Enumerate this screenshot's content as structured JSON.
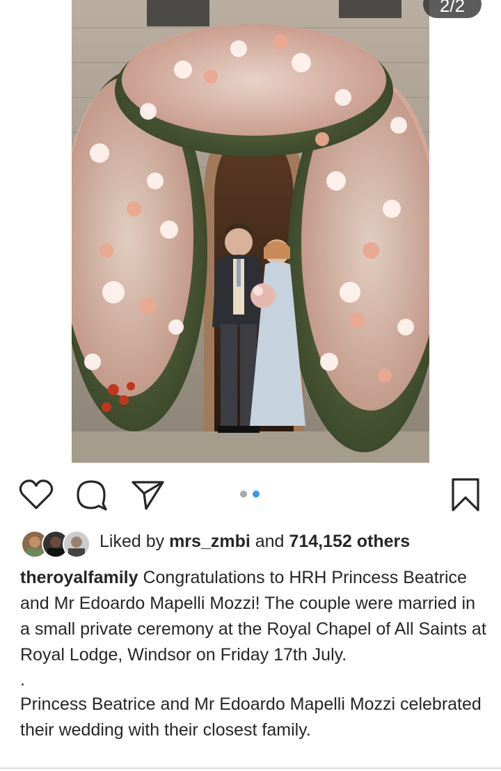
{
  "post": {
    "image_alt": "Wedding photo: couple in front of a floral arch at a chapel doorway",
    "carousel_counter": "2/2",
    "carousel": {
      "total": 2,
      "active_index": 1
    }
  },
  "actions": {
    "like_icon": "heart-icon",
    "comment_icon": "comment-icon",
    "share_icon": "share-icon",
    "save_icon": "bookmark-icon"
  },
  "likes": {
    "prefix": "Liked by",
    "user": "mrs_zmbi",
    "middle": "and",
    "count_text": "714,152 others"
  },
  "caption": {
    "username": "theroyalfamily",
    "text": " Congratulations to HRH Princess Beatrice and Mr Edoardo Mapelli Mozzi! The couple were married in a small private ceremony at the Royal Chapel of All Saints at Royal Lodge, Windsor on Friday 17th July.",
    "separator": ".",
    "second_paragraph": "Princess Beatrice and Mr Edoardo Mapelli Mozzi celebrated their wedding with their closest family."
  },
  "colors": {
    "text": "#262626",
    "active_dot": "#3897f0",
    "inactive_dot": "#a8a8a8"
  }
}
